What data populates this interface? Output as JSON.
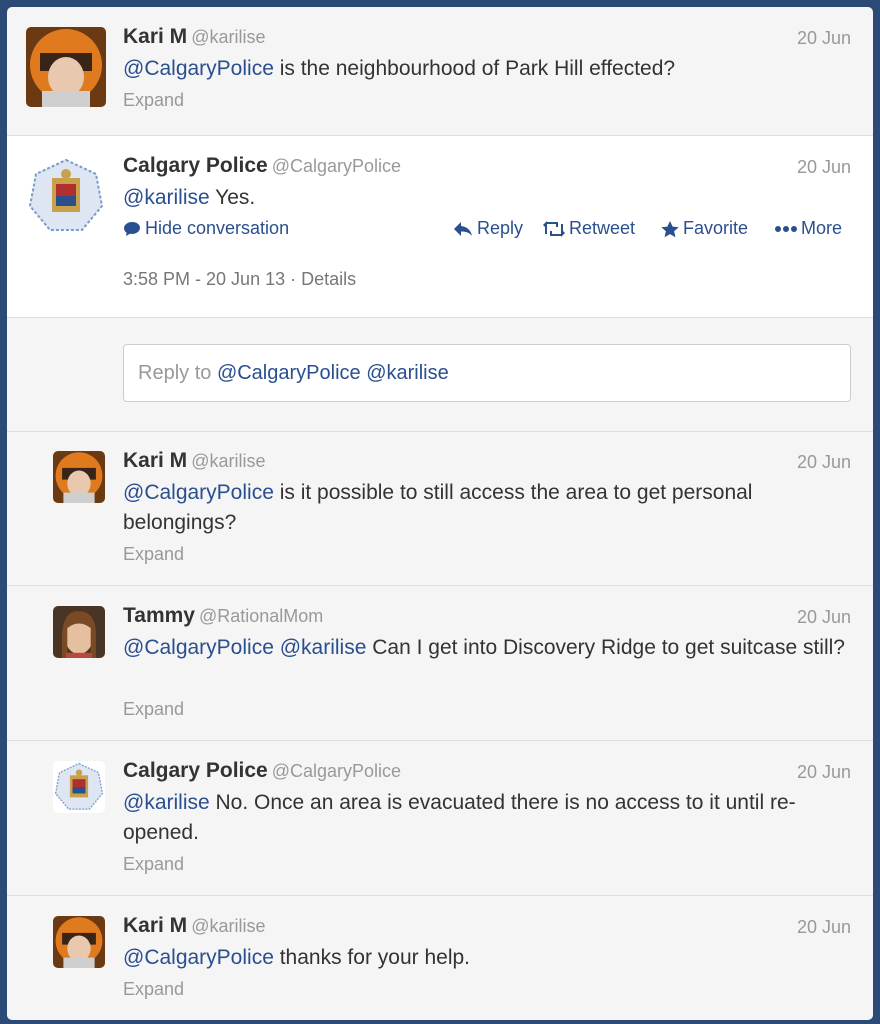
{
  "tweets": [
    {
      "name": "Kari M",
      "handle": "@karilise",
      "date": "20 Jun",
      "mention": "@CalgaryPolice",
      "text": " is the neighbourhood of Park Hill effected?",
      "expand": "Expand"
    },
    {
      "name": "Calgary Police",
      "handle": "@CalgaryPolice",
      "date": "20 Jun",
      "mention": "@karilise",
      "text": " Yes.",
      "actions": {
        "hide": "Hide conversation",
        "reply": "Reply",
        "retweet": "Retweet",
        "favorite": "Favorite",
        "more": "More"
      },
      "timestamp": "3:58 PM - 20 Jun 13",
      "details": "Details"
    },
    {
      "name": "Kari M",
      "handle": "@karilise",
      "date": "20 Jun",
      "mention": "@CalgaryPolice",
      "text": " is it possible to still access the area to get personal belongings?",
      "expand": "Expand"
    },
    {
      "name": "Tammy",
      "handle": "@RationalMom",
      "date": "20 Jun",
      "mention": "@CalgaryPolice",
      "mention2": "@karilise",
      "text": " Can I get into Discovery Ridge to get suitcase still?",
      "expand": "Expand"
    },
    {
      "name": "Calgary Police",
      "handle": "@CalgaryPolice",
      "date": "20 Jun",
      "mention": "@karilise",
      "text": " No. Once an area is evacuated there is no access to it until re-opened.",
      "expand": "Expand"
    },
    {
      "name": "Kari M",
      "handle": "@karilise",
      "date": "20 Jun",
      "mention": "@CalgaryPolice",
      "text": " thanks for your help.",
      "expand": "Expand"
    }
  ],
  "reply_box": {
    "prefix": "Reply to ",
    "mention1": "@CalgaryPolice",
    "mention2": "@karilise"
  },
  "colors": {
    "link": "#2a4f8f",
    "background": "#2c4a78",
    "panel": "#f5f5f5"
  },
  "icons": [
    "speech-bubble-icon",
    "reply-arrow-icon",
    "retweet-icon",
    "star-icon",
    "more-dots-icon"
  ]
}
